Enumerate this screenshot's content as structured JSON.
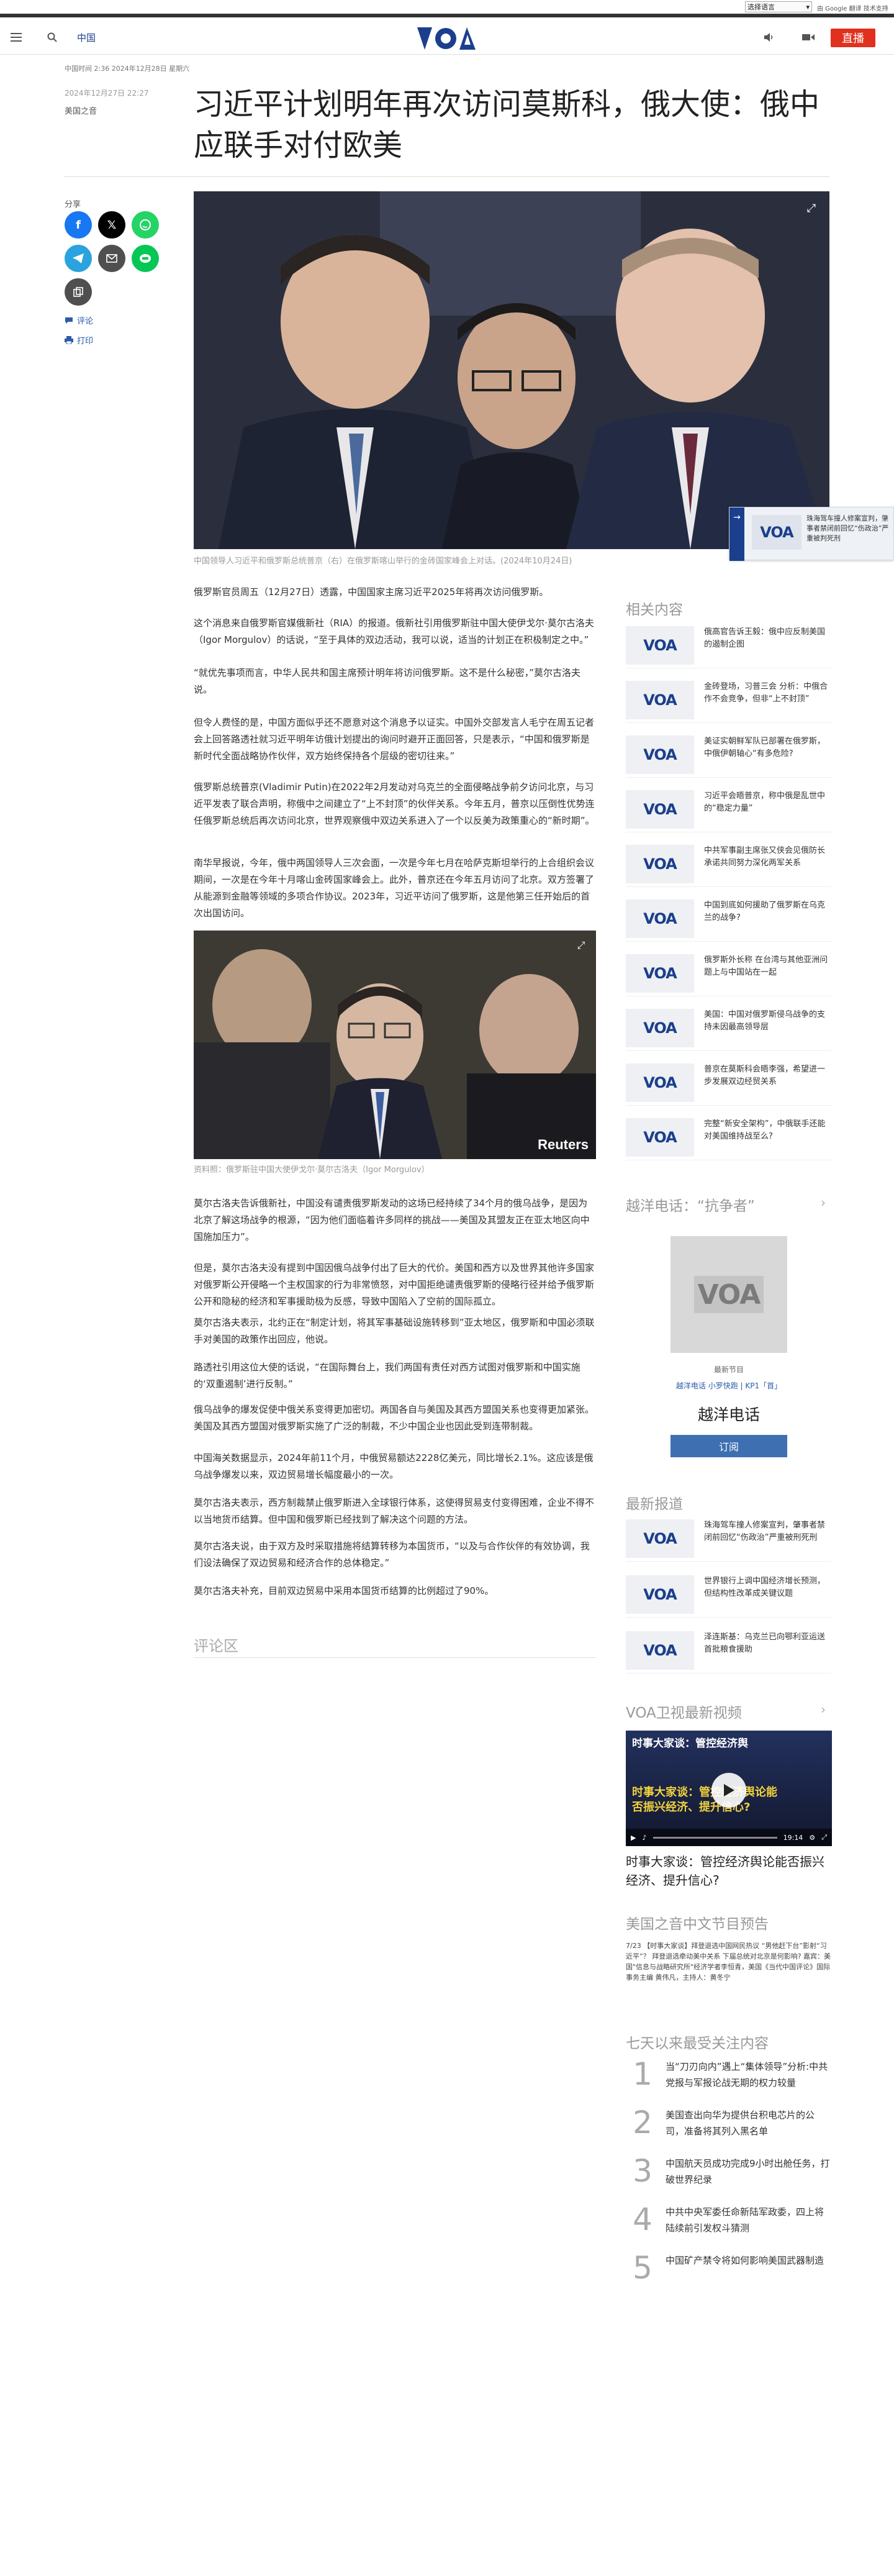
{
  "topbar": {
    "language_select": "选择语言",
    "google_label": "由 Google 翻译 技术支持"
  },
  "header": {
    "site_name": "中国",
    "logo": "VOA",
    "live_label": "直播"
  },
  "article": {
    "breadcrumb_date": "中国时间 2:36 2024年12月28日 星期六",
    "published": "2024年12月27日 22:27",
    "author": "美国之音",
    "title": "习近平计划明年再次访问莫斯科，俄大使：俄中应联手对付欧美",
    "hero_caption": "中国领导人习近平和俄罗斯总统普京（右）在俄罗斯喀山举行的金砖国家峰会上对话。(2024年10月24日)",
    "paragraphs_a": [
      "俄罗斯官员周五（12月27日）透露，中国国家主席习近平2025年将再次访问俄罗斯。",
      "这个消息来自俄罗斯官媒俄新社（RIA）的报道。俄新社引用俄罗斯驻中国大使伊戈尔·莫尔古洛夫（Igor Morgulov）的话说，“至于具体的双边活动，我可以说，适当的计划正在积极制定之中。”",
      "“就优先事项而言，中华人民共和国主席预计明年将访问俄罗斯。这不是什么秘密，”莫尔古洛夫说。",
      "但令人费怪的是，中国方面似乎还不愿意对这个消息予以证实。中国外交部发言人毛宁在周五记者会上回答路透社就习近平明年访俄计划提出的询问时避开正面回答，只是表示，“中国和俄罗斯是新时代全面战略协作伙伴，双方始终保持各个层级的密切往来。”",
      "俄罗斯总统普京(Vladimir Putin)在2022年2月发动对乌克兰的全面侵略战争前夕访问北京，与习近平发表了联合声明，称俄中之间建立了“上不封顶”的伙伴关系。今年五月，普京以压倒性优势连任俄罗斯总统后再次访问北京，世界观察俄中双边关系进入了一个以反美为政策重心的“新时期”。",
      "南华早报说，今年，俄中两国领导人三次会面，一次是今年七月在哈萨克斯坦举行的上合组织会议期间，一次是在今年十月喀山金砖国家峰会上。此外，普京还在今年五月访问了北京。双方签署了从能源到金融等领域的多项合作协议。2023年，习近平访问了俄罗斯，这是他第三任开始后的首次出国访问。"
    ],
    "photo2_caption": "资料照：俄罗斯驻中国大使伊戈尔·莫尔古洛夫（Igor Morgulov）",
    "photo2_watermark": "Reuters",
    "paragraphs_b": [
      "莫尔古洛夫告诉俄新社，中国没有谴责俄罗斯发动的这场已经持续了34个月的俄乌战争，是因为北京了解这场战争的根源，“因为他们面临着许多同样的挑战——美国及其盟友正在亚太地区向中国施加压力”。",
      "但是，莫尔古洛夫没有提到中国因俄乌战争付出了巨大的代价。美国和西方以及世界其他许多国家对俄罗斯公开侵略一个主权国家的行为非常愤怒，对中国拒绝谴责俄罗斯的侵略行径并给予俄罗斯公开和隐秘的经济和军事援助极为反感，导致中国陷入了空前的国际孤立。",
      "莫尔古洛夫表示，北约正在“制定计划，将其军事基础设施转移到”亚太地区，俄罗斯和中国必须联手对美国的政策作出回应，他说。",
      "路透社引用这位大使的话说，“在国际舞台上，我们两国有责任对西方试图对俄罗斯和中国实施的‘双重遏制’进行反制。”",
      "俄乌战争的爆发促使中俄关系变得更加密切。两国各自与美国及其西方盟国关系也变得更加紧张。美国及其西方盟国对俄罗斯实施了广泛的制裁，不少中国企业也因此受到连带制裁。",
      "中国海关数据显示，2024年前11个月，中俄贸易额达2228亿美元，同比增长2.1%。这应该是俄乌战争爆发以来，双边贸易增长幅度最小的一次。",
      "莫尔古洛夫表示，西方制裁禁止俄罗斯进入全球银行体系，这使得贸易支付变得困难，企业不得不以当地货币结算。但中国和俄罗斯已经找到了解决这个问题的方法。",
      "莫尔古洛夫说，由于双方及时采取措施将结算转移为本国货币，“以及与合作伙伴的有效协调，我们设法确保了双边贸易和经济合作的总体稳定。”",
      "莫尔古洛夫补充，目前双边贸易中采用本国货币结算的比例超过了90%。"
    ],
    "comments_heading": "评论区"
  },
  "share": {
    "label": "分享",
    "comment": "评论",
    "print": "打印"
  },
  "related": {
    "heading": "相关内容",
    "items": [
      "俄高官告诉王毅：俄中应反制美国的遏制企图",
      "金砖登场，习普三会 分析：中俄合作不会竞争，但非“上不封顶”",
      "美证实朝鲜军队已部署在俄罗斯，中俄伊朝轴心“有多危险?",
      "习近平会晤普京，称中俄是乱世中的“稳定力量”",
      "中共军事副主席张又侠会见俄防长 承诺共同努力深化两军关系",
      "中国到底如何援助了俄罗斯在乌克兰的战争?",
      "俄罗斯外长称 在台湾与其他亚洲问题上与中国站在一起",
      "美国：中国对俄罗斯侵乌战争的支持未因最高领导层",
      "普京在莫斯科会晤李强，希望进一步发展双边经贸关系",
      "完整“新安全架构”，中俄联手还能对美国维持战至么?"
    ]
  },
  "radio": {
    "heading": "越洋电话：“抗争者”",
    "label": "最新节目",
    "links": "越洋电话 小罗快跑 | KP1「首」",
    "title": "越洋电话",
    "subscribe": "订阅"
  },
  "latest": {
    "heading": "最新报道",
    "items": [
      "珠海驾车撞人修案宣判，肇事者禁闭前回忆“伤政治”严重被刑死刑",
      "世界银行上调中国经济增长预测，但结构性改革成关键议题",
      "泽连斯基：乌克兰已向鄂利亚运送首批粮食援助"
    ]
  },
  "video": {
    "heading": "VOA卫视最新视频",
    "thumb_title": "时事大家谈：管控经济舆论能否振兴经济、提升信心?",
    "time": "19:14",
    "caption": "时事大家谈：管控经济舆论能否振兴经济、提升信心?"
  },
  "digest": {
    "heading": "美国之音中文节目预告",
    "text": "7/23 【时事大家谈】拜登退选中国网民热议 “男他赶下台”影射“习近平”？ 拜登退选牵动美中关系 下届总统对北京是何影响? 嘉宾：美国\"信息与战略研究所\"经济学者李恒青，美国《当代中国评论》国际事务主编 黄伟凡，主持人：黄冬宁"
  },
  "popular": {
    "heading": "七天以来最受关注内容",
    "items": [
      {
        "rank": "1",
        "text": "当“刀刃向内”遇上“集体领导”分析:中共党报与军报论战无期的权力较量"
      },
      {
        "rank": "2",
        "text": "美国查出向华为提供台积电芯片的公司，准备将其列入黑名单"
      },
      {
        "rank": "3",
        "text": "中国航天员成功完成9小时出舱任务，打破世界纪录"
      },
      {
        "rank": "4",
        "text": "中共中央军委任命新陆军政委，四上将陆续前引发权斗猜测"
      },
      {
        "rank": "5",
        "text": "中国矿产禁令将如何影响美国武器制造"
      }
    ]
  },
  "floating_card": {
    "text": "珠海驾车撞人修案宣判，肇事者禁闭前回忆“伤政治”严重被判死刑"
  },
  "colors": {
    "brand": "#1b3f8c",
    "live": "#e0301e",
    "accent_link": "#2a5ba8"
  }
}
